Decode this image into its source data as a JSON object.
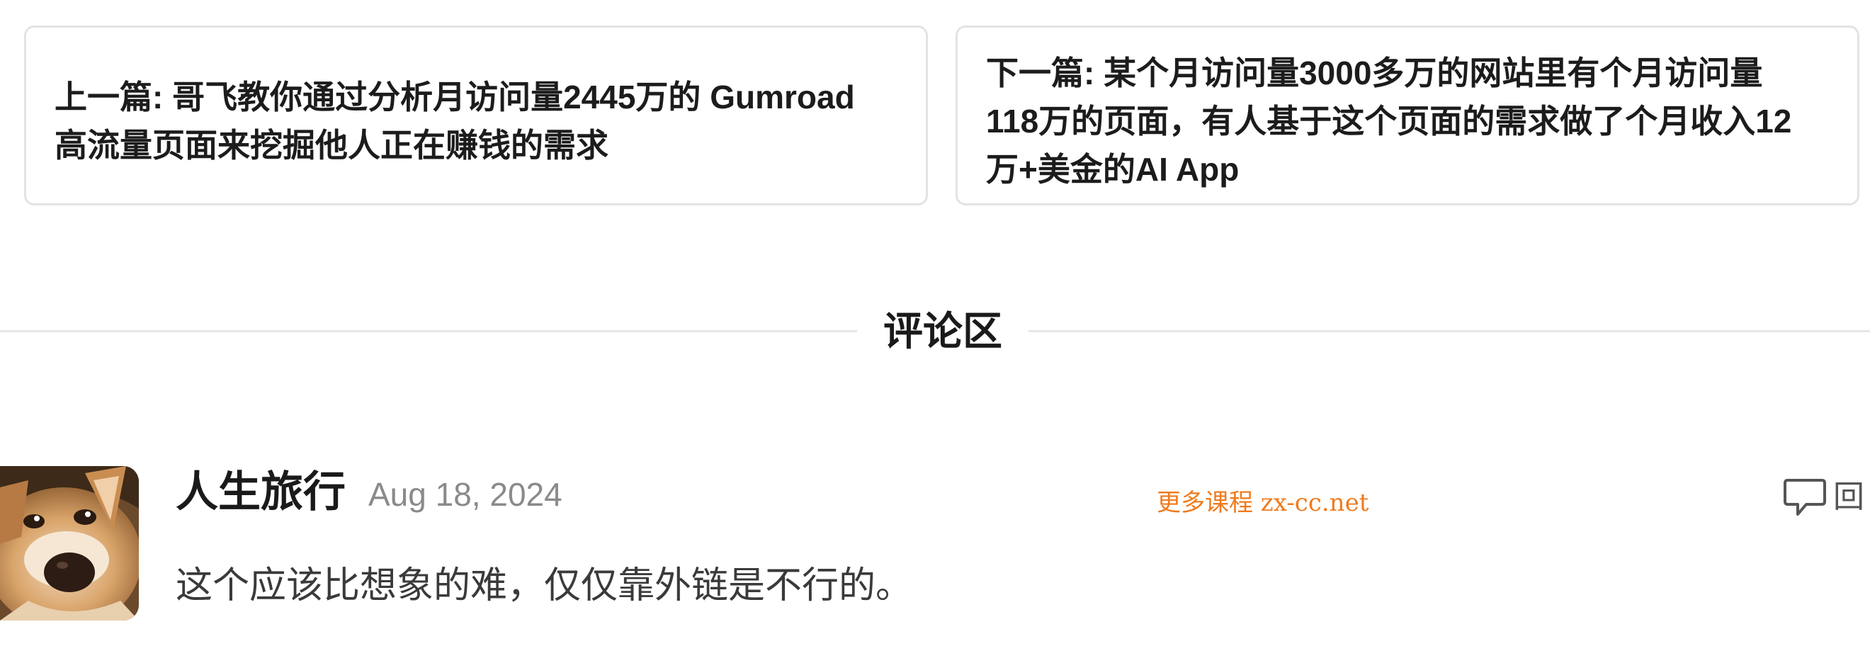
{
  "navigation": {
    "prev_line1": "上一篇: 哥飞教你通过分析月访问量2445万的 Gumroad",
    "prev_line2": "高流量页面来挖掘他人正在赚钱的需求",
    "next_line1": "下一篇: 某个月访问量3000多万的网站里有个月访问量",
    "next_line2": "118万的页面，有人基于这个页面的需求做了个月收入12",
    "next_line3": "万+美金的AI App"
  },
  "comments_section": {
    "title": "评论区"
  },
  "comments": [
    {
      "author": "人生旅行",
      "date": "Aug 18, 2024",
      "text": "这个应该比想象的难，仅仅靠外链是不行的。",
      "reply_label": "回",
      "avatar_icon": "dog-avatar"
    }
  ],
  "watermark": "更多课程 zx-cc.net",
  "colors": {
    "card_border": "#e3e3e3",
    "divider": "#e6e6e6",
    "watermark": "#f07a1c",
    "muted_text": "#8a8a8a"
  }
}
